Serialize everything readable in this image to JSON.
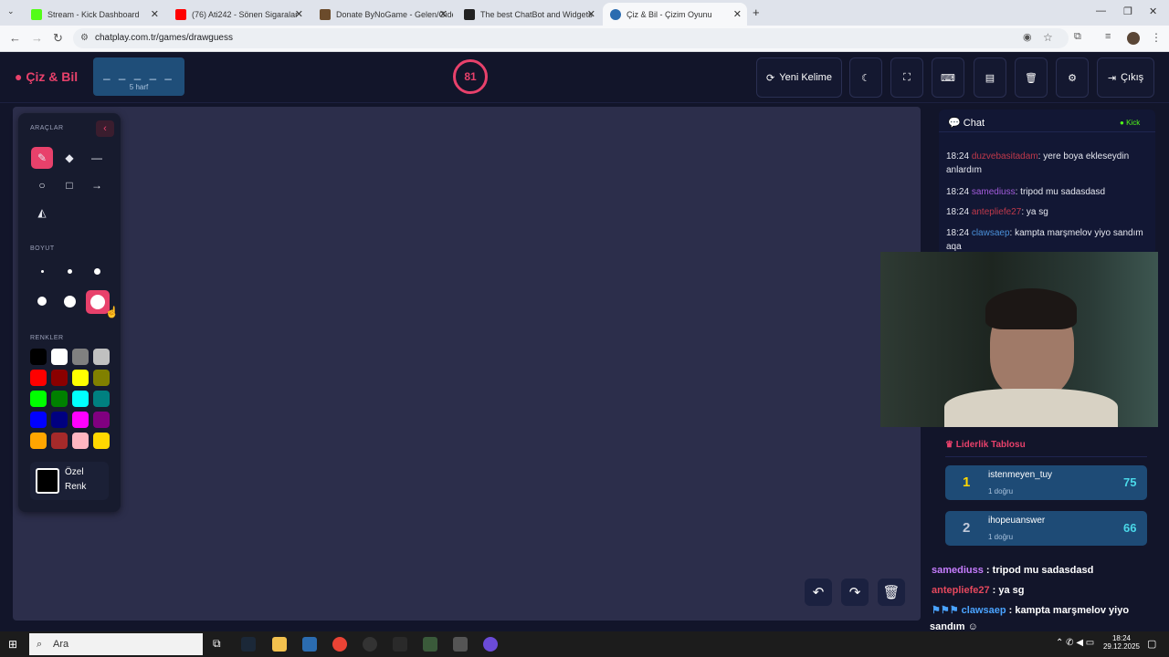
{
  "browser": {
    "tabs": [
      {
        "label": "Stream - Kick Dashboard",
        "active": false,
        "icon_color": "#53fc18"
      },
      {
        "label": "(76) Ati242 - Sönen Sigaralar",
        "active": false,
        "icon_color": "#ff0000"
      },
      {
        "label": "Donate ByNoGame - Gelen/Giden",
        "active": false,
        "icon_color": "#6b4b2b"
      },
      {
        "label": "The best ChatBot and Widgets",
        "active": false,
        "icon_color": "#222222"
      },
      {
        "label": "Çiz & Bil - Çizim Oyunu",
        "active": true,
        "icon_color": "#2b6cb0"
      }
    ],
    "url": "chatplay.com.tr/games/drawguess"
  },
  "header": {
    "logo": "Çiz & Bil",
    "word_blanks": "_ _ _ _ _",
    "word_length": "5 harf",
    "timer": "81",
    "new_word_label": "Yeni Kelime",
    "exit_label": "Çıkış"
  },
  "tools": {
    "tools_heading": "ARAÇLAR",
    "size_heading": "BOYUT",
    "colors_heading": "RENKLER",
    "custom_color_line1": "Özel",
    "custom_color_line2": "Renk",
    "colors": [
      "#000000",
      "#ffffff",
      "#808080",
      "#c0c0c0",
      "#ff0000",
      "#8b0000",
      "#ffff00",
      "#808000",
      "#00ff00",
      "#008000",
      "#00ffff",
      "#008080",
      "#0000ff",
      "#000080",
      "#ff00ff",
      "#800080",
      "#ffa500",
      "#a52a2a",
      "#ffb6c1",
      "#ffd700"
    ]
  },
  "chat": {
    "title": "Chat",
    "platform": "Kick",
    "messages": [
      {
        "time": "18:24",
        "user": "duzvebasitadam",
        "text": ": yere boya ekleseydin anlardım",
        "color": "#c0394b"
      },
      {
        "time": "18:24",
        "user": "samediuss",
        "text": ": tripod mu sadasdasd",
        "color": "#a35cdb"
      },
      {
        "time": "18:24",
        "user": "antepliefe27",
        "text": ": ya sg",
        "color": "#c0394b"
      },
      {
        "time": "18:24",
        "user": "clawsaep",
        "text": ": kampta marşmelov yiyo sandım aqa",
        "color": "#4a90d9"
      }
    ]
  },
  "leaderboard": {
    "title": "Liderlik Tablosu",
    "rows": [
      {
        "rank": "1",
        "name": "istenmeyen_tuy",
        "sub": "1 doğru",
        "score": "75"
      },
      {
        "rank": "2",
        "name": "ihopeuanswer",
        "sub": "1 doğru",
        "score": "66"
      }
    ]
  },
  "overlay_chat": [
    {
      "user": "samediuss",
      "text": " : tripod mu sadasdasd",
      "color": "#c77dff"
    },
    {
      "user": "antepliefe27",
      "text": " : ya sg",
      "color": "#e5485d"
    },
    {
      "user": "clawsaep",
      "text": " : kampta marşmelov yiyo",
      "color": "#4aa3ff"
    },
    {
      "user": "",
      "text": "sandım",
      "color": "#ffffff"
    }
  ],
  "taskbar": {
    "search": "Ara",
    "time": "18:24",
    "date": "29.12.2025"
  }
}
